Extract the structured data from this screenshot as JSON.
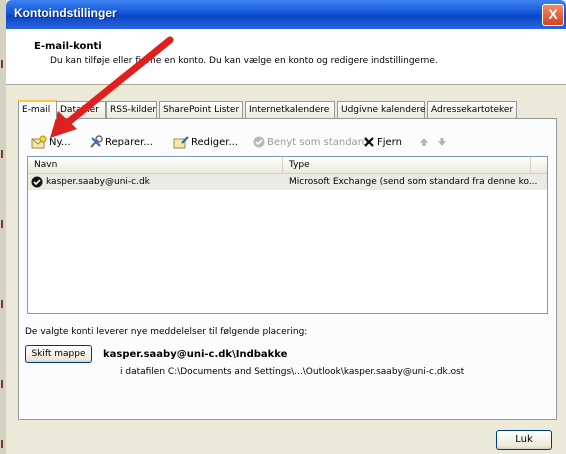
{
  "window": {
    "title": "Kontoindstillinger",
    "close_symbol": "X"
  },
  "header": {
    "title": "E-mail-konti",
    "description": "Du kan tilføje eller fjerne en konto. Du kan vælge en konto og redigere indstillingerne."
  },
  "tabs": [
    {
      "label": "E-mail",
      "active": true
    },
    {
      "label": "Datafiler"
    },
    {
      "label": "RSS-kilder"
    },
    {
      "label": "SharePoint Lister"
    },
    {
      "label": "Internetkalendere"
    },
    {
      "label": "Udgivne kalendere"
    },
    {
      "label": "Adressekartoteker"
    }
  ],
  "toolbar": {
    "new_label": "Ny...",
    "repair_label": "Reparer...",
    "edit_label": "Rediger...",
    "default_label": "Benyt som standard",
    "remove_label": "Fjern"
  },
  "accounts": {
    "headers": {
      "name": "Navn",
      "type": "Type"
    },
    "rows": [
      {
        "name": "kasper.saaby@uni-c.dk",
        "type": "Microsoft Exchange (send som standard fra denne ko..."
      }
    ]
  },
  "delivery": {
    "label": "De valgte konti leverer nye meddelelser til følgende placering:",
    "change_folder_label": "Skift mappe",
    "folder_path": "kasper.saaby@uni-c.dk\\Indbakke",
    "data_file": "i datafilen C:\\Documents and Settings\\...\\Outlook\\kasper.saaby@uni-c.dk.ost"
  },
  "footer": {
    "close_label": "Luk"
  },
  "colors": {
    "titlebar": "#0a45c4",
    "arrow": "#e0201e",
    "tab_highlight": "#ffc83c",
    "list_border": "#7f9db9"
  }
}
